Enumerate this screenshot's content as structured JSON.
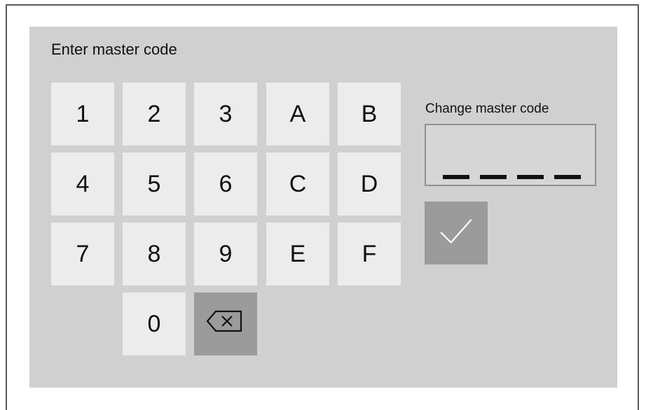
{
  "header": {
    "title": "Enter master code"
  },
  "keypad": {
    "keys": [
      "1",
      "2",
      "3",
      "A",
      "B",
      "4",
      "5",
      "6",
      "C",
      "D",
      "7",
      "8",
      "9",
      "E",
      "F",
      "0"
    ],
    "backspace_icon": "backspace-icon"
  },
  "change_code": {
    "label": "Change master code",
    "placeholder": "____",
    "confirm_icon": "checkmark-icon"
  },
  "colors": {
    "panel": "#d0d0d0",
    "key": "#ececec",
    "action_key": "#9b9b9b"
  }
}
